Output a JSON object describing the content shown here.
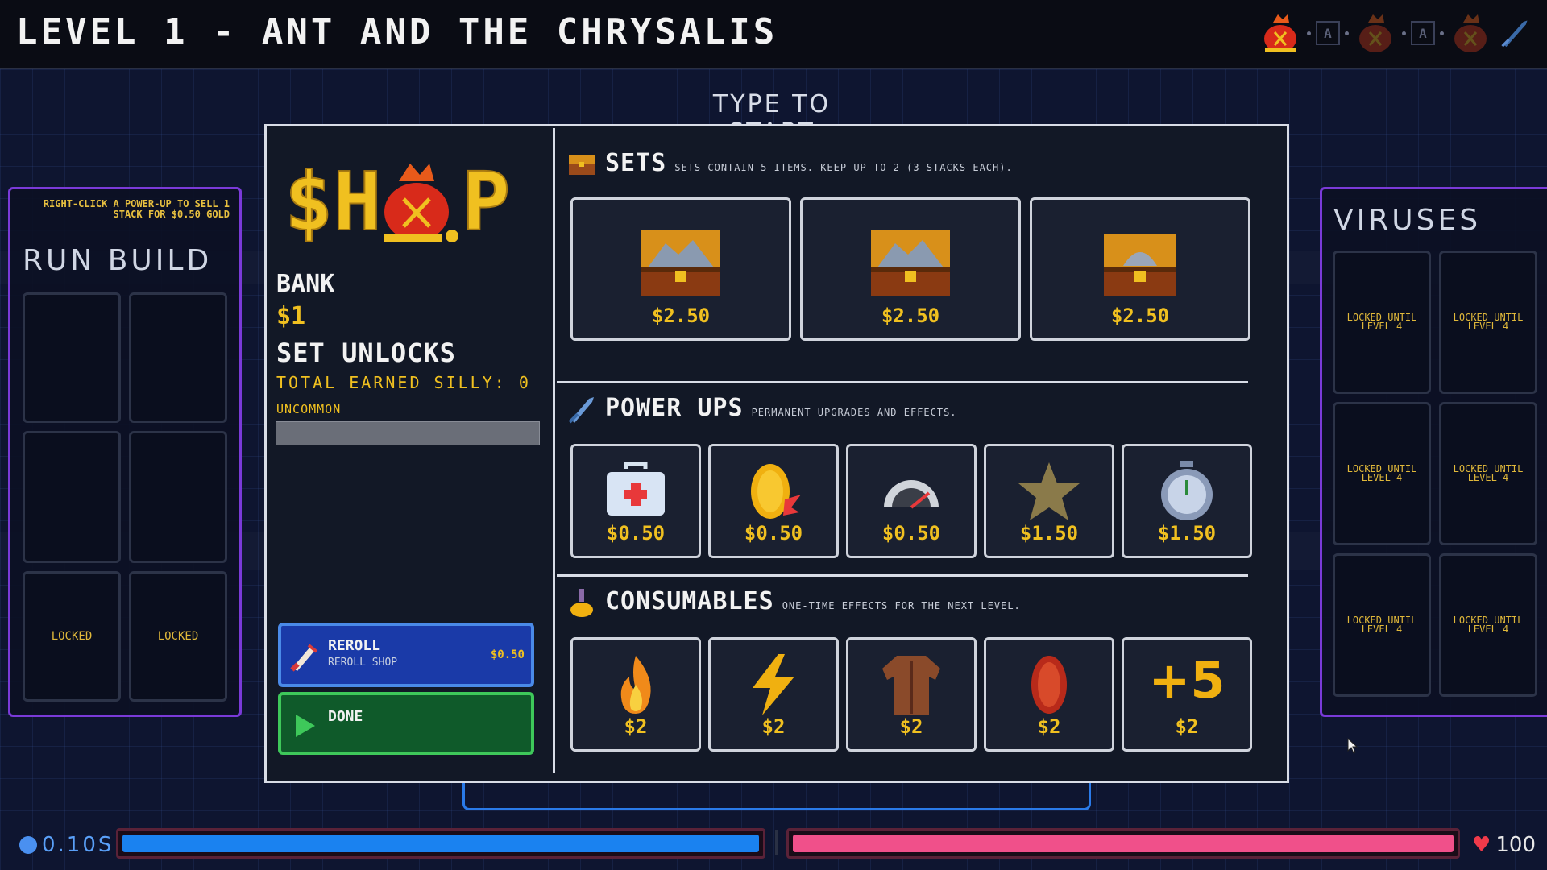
{
  "header": {
    "level_title": "LEVEL 1 - ANT AND THE CHRYSALIS",
    "progress_chips": [
      "A",
      "A"
    ]
  },
  "prompt": "TYPE TO START",
  "run_build": {
    "hint": "RIGHT-CLICK A POWER-UP TO SELL 1 STACK FOR $0.50 GOLD",
    "title": "RUN BUILD",
    "slots": [
      "",
      "",
      "",
      "",
      "LOCKED",
      "LOCKED"
    ]
  },
  "viruses": {
    "title": "VIRUSES",
    "slots": [
      "LOCKED UNTIL LEVEL 4",
      "LOCKED UNTIL LEVEL 4",
      "LOCKED UNTIL LEVEL 4",
      "LOCKED UNTIL LEVEL 4",
      "LOCKED UNTIL LEVEL 4",
      "LOCKED UNTIL LEVEL 4"
    ]
  },
  "shop": {
    "logo_text": "$H P",
    "bank_label": "BANK",
    "bank_value": "$1",
    "set_unlocks_label": "SET UNLOCKS",
    "total_earned": "TOTAL EARNED SILLY: 0",
    "rarity_label": "UNCOMMON",
    "rarity_progress": 0,
    "reroll": {
      "title": "REROLL",
      "subtitle": "REROLL SHOP",
      "price": "$0.50"
    },
    "done": {
      "title": "DONE"
    },
    "sets": {
      "title": "SETS",
      "subtitle": "SETS CONTAIN 5 ITEMS. KEEP UP TO 2 (3 STACKS EACH).",
      "items": [
        {
          "icon": "chest-mountain-icon",
          "price": "$2.50"
        },
        {
          "icon": "chest-mountain-icon",
          "price": "$2.50"
        },
        {
          "icon": "chest-helmet-icon",
          "price": "$2.50"
        }
      ]
    },
    "power_ups": {
      "title": "POWER UPS",
      "subtitle": "PERMANENT UPGRADES AND EFFECTS.",
      "items": [
        {
          "icon": "medkit-icon",
          "price": "$0.50"
        },
        {
          "icon": "gold-coin-icon",
          "price": "$0.50"
        },
        {
          "icon": "gauge-icon",
          "price": "$0.50"
        },
        {
          "icon": "star-icon",
          "price": "$1.50"
        },
        {
          "icon": "stopwatch-icon",
          "price": "$1.50"
        }
      ]
    },
    "consumables": {
      "title": "CONSUMABLES",
      "subtitle": "ONE-TIME EFFECTS FOR THE NEXT LEVEL.",
      "items": [
        {
          "icon": "fire-icon",
          "price": "$2"
        },
        {
          "icon": "lightning-icon",
          "price": "$2"
        },
        {
          "icon": "jacket-icon",
          "price": "$2"
        },
        {
          "icon": "shield-icon",
          "price": "$2"
        },
        {
          "icon": "plus-five-icon",
          "label": "+5",
          "price": "$2"
        }
      ]
    }
  },
  "hud": {
    "timer": "0.10S",
    "timer_fill": 1.0,
    "health": "100",
    "health_fill": 1.0
  },
  "colors": {
    "gold": "#f0c020",
    "accent_purple": "#7a3ad8",
    "timer_blue": "#1a82f0",
    "health_pink": "#f0508a"
  }
}
